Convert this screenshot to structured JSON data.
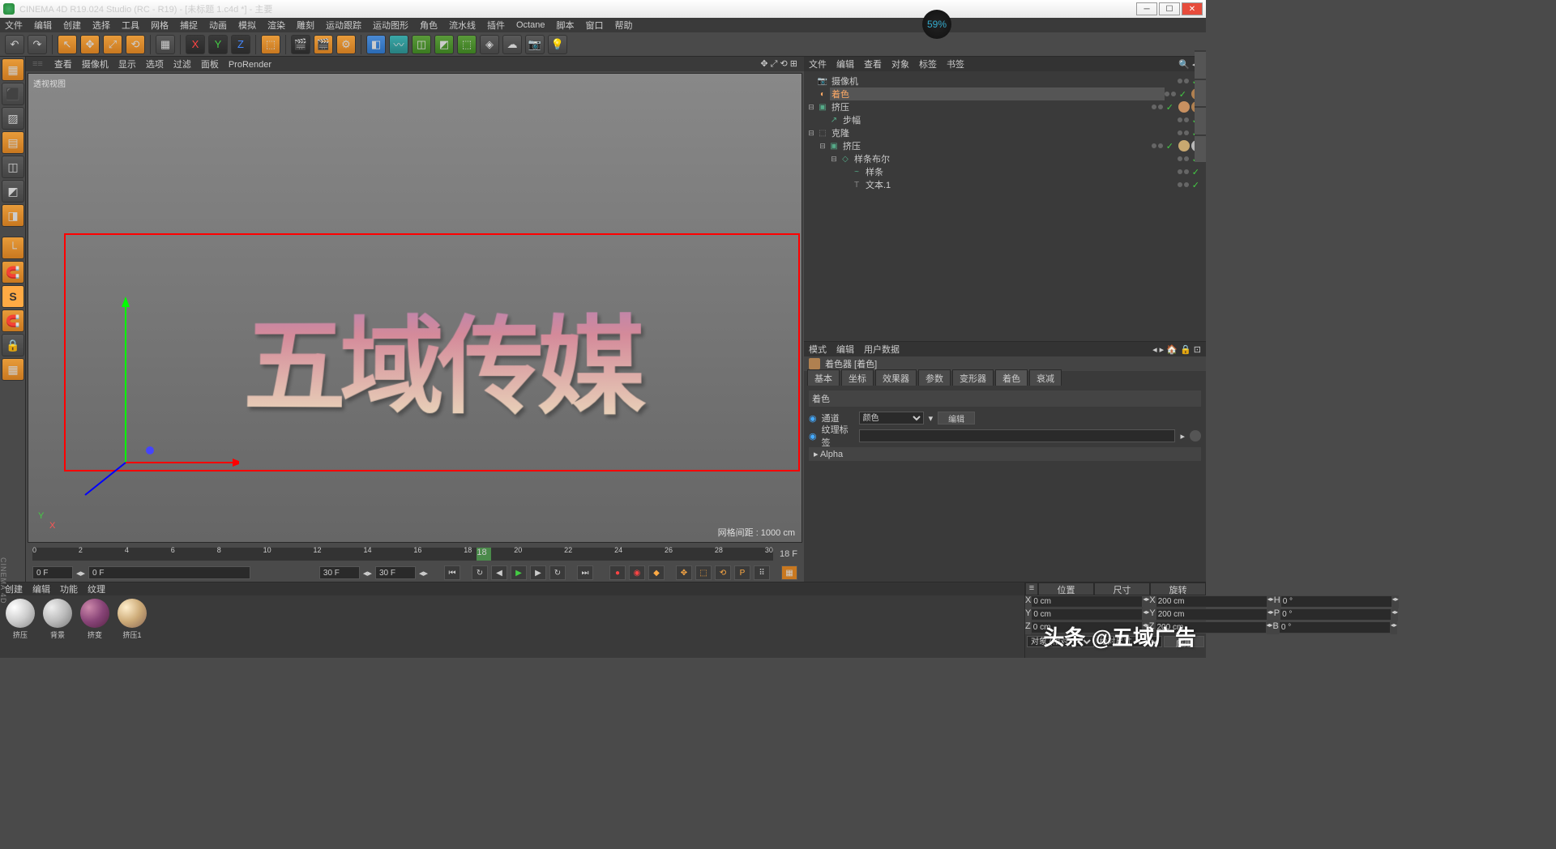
{
  "title": "CINEMA 4D R19.024 Studio (RC - R19) - [未标题 1.c4d *] - 主要",
  "menu": [
    "文件",
    "编辑",
    "创建",
    "选择",
    "工具",
    "网格",
    "捕捉",
    "动画",
    "模拟",
    "渲染",
    "雕刻",
    "运动跟踪",
    "运动图形",
    "角色",
    "流水线",
    "插件",
    "Octane",
    "脚本",
    "窗口",
    "帮助"
  ],
  "viewTabs": [
    "查看",
    "摄像机",
    "显示",
    "选项",
    "过滤",
    "面板",
    "ProRender"
  ],
  "viewportLabel": "透视视图",
  "gridStatus": "网格间距 : 1000 cm",
  "axisY": "Y",
  "axisX": "X",
  "objMenu": [
    "文件",
    "编辑",
    "查看",
    "对象",
    "标签",
    "书签"
  ],
  "tree": [
    {
      "ind": 0,
      "exp": "",
      "icon": "📷",
      "name": "摄像机",
      "c": "#888",
      "tags": []
    },
    {
      "ind": 0,
      "exp": "",
      "icon": "◐",
      "name": "着色",
      "c": "#fa6",
      "sel": true,
      "tags": [
        "#b08050"
      ]
    },
    {
      "ind": 0,
      "exp": "⊟",
      "icon": "▣",
      "name": "挤压",
      "c": "#5a8",
      "tags": [
        "#c89060",
        "#b08050"
      ]
    },
    {
      "ind": 1,
      "exp": "",
      "icon": "↗",
      "name": "步幅",
      "c": "#5a8",
      "tags": []
    },
    {
      "ind": 0,
      "exp": "⊟",
      "icon": "⬚",
      "name": "克隆",
      "c": "#888",
      "tags": []
    },
    {
      "ind": 1,
      "exp": "⊟",
      "icon": "▣",
      "name": "挤压",
      "c": "#5a8",
      "tags": [
        "#c8a870",
        "#b8b8b8"
      ]
    },
    {
      "ind": 2,
      "exp": "⊟",
      "icon": "◇",
      "name": "样条布尔",
      "c": "#5a8",
      "tags": []
    },
    {
      "ind": 3,
      "exp": "",
      "icon": "~",
      "name": "样条",
      "c": "#5a8",
      "tags": []
    },
    {
      "ind": 3,
      "exp": "",
      "icon": "T",
      "name": "文本.1",
      "c": "#888",
      "tags": []
    }
  ],
  "attrMenu": [
    "模式",
    "编辑",
    "用户数据"
  ],
  "attrTitle": "着色器 [着色]",
  "attrTabs": [
    "基本",
    "坐标",
    "效果器",
    "参数",
    "变形器",
    "着色",
    "衰减"
  ],
  "attrActive": "着色",
  "shader": {
    "heading": "着色",
    "channel": "通道",
    "channelVal": "颜色",
    "editBtn": "编辑",
    "texTag": "纹理标签",
    "alpha": "▸ Alpha"
  },
  "timeline": {
    "ticks": [
      "0",
      "2",
      "4",
      "6",
      "8",
      "10",
      "12",
      "14",
      "16",
      "18",
      "20",
      "22",
      "24",
      "26",
      "28",
      "30"
    ],
    "current": "18",
    "endLabel": "18 F",
    "f1": "0 F",
    "f2": "0 F",
    "f3": "30 F",
    "f4": "30 F"
  },
  "matMenu": [
    "创建",
    "编辑",
    "功能",
    "纹理"
  ],
  "materials": [
    {
      "name": "挤压",
      "bg": "radial-gradient(circle at 30% 30%,#fff,#ccc,#888)"
    },
    {
      "name": "背景",
      "bg": "radial-gradient(circle at 30% 30%,#eee,#bbb,#777)"
    },
    {
      "name": "挤变",
      "bg": "radial-gradient(circle at 30% 30%,#c8a,#847,#524)"
    },
    {
      "name": "挤压1",
      "bg": "radial-gradient(circle at 30% 30%,#fec,#ca7,#865)"
    }
  ],
  "coord": {
    "hdrs": [
      "位置",
      "尺寸",
      "旋转"
    ],
    "rows": [
      {
        "l": "X",
        "p": "0 cm",
        "s": "200 cm",
        "rl": "H",
        "r": "0 °"
      },
      {
        "l": "Y",
        "p": "0 cm",
        "s": "200 cm",
        "rl": "P",
        "r": "0 °"
      },
      {
        "l": "Z",
        "p": "0 cm",
        "s": "200 cm",
        "rl": "B",
        "r": "0 °"
      }
    ],
    "sel1": "对象 (相对)",
    "sel2": "绝对尺寸",
    "apply": "应用"
  },
  "overlayPct": "59%",
  "watermark": "头条 @五域广告",
  "sidebarTxt": "CINEMA 4D",
  "text3d": "五域传媒"
}
